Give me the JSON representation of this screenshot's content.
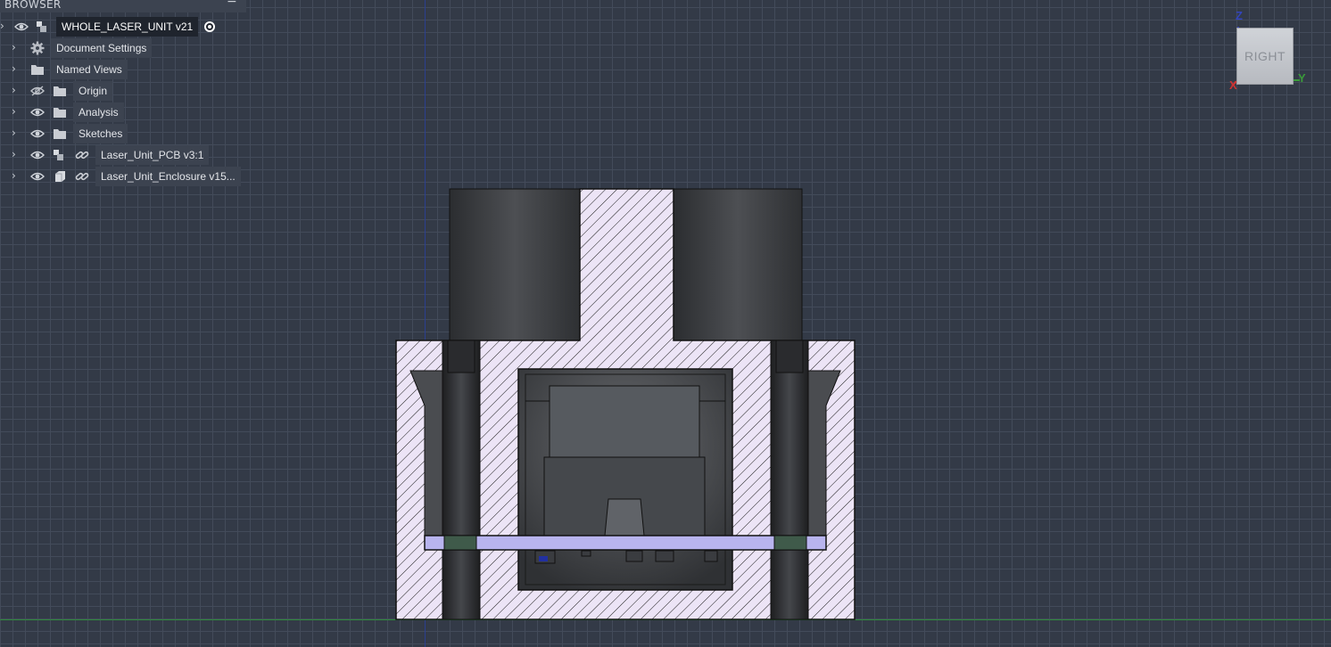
{
  "browser": {
    "title": "BROWSER",
    "collapse_symbol": "−",
    "root": {
      "label": "WHOLE_LASER_UNIT v21",
      "icon": "component-icon"
    },
    "items": [
      {
        "label": "Document Settings",
        "icon": "gear-icon",
        "visible": null
      },
      {
        "label": "Named Views",
        "icon": "folder-icon",
        "visible": null
      },
      {
        "label": "Origin",
        "icon": "folder-icon",
        "visible": false
      },
      {
        "label": "Analysis",
        "icon": "folder-icon",
        "visible": true
      },
      {
        "label": "Sketches",
        "icon": "folder-icon",
        "visible": true
      },
      {
        "label": "Laser_Unit_PCB v3:1",
        "icon": "component-icon",
        "visible": true,
        "linked": true
      },
      {
        "label": "Laser_Unit_Enclosure v15...",
        "icon": "body-icon",
        "visible": true,
        "linked": true
      }
    ]
  },
  "viewcube": {
    "face": "RIGHT",
    "axis_z": "Z",
    "axis_x": "X",
    "axis_y": "Y"
  },
  "colors": {
    "background": "#333a47",
    "grid": "#434b5a",
    "section_fill": "#ece4f6",
    "pcb": "#b8b4ee",
    "x_axis": "#cc3333",
    "y_axis": "#3a9a3a",
    "z_axis": "#3344bb"
  }
}
